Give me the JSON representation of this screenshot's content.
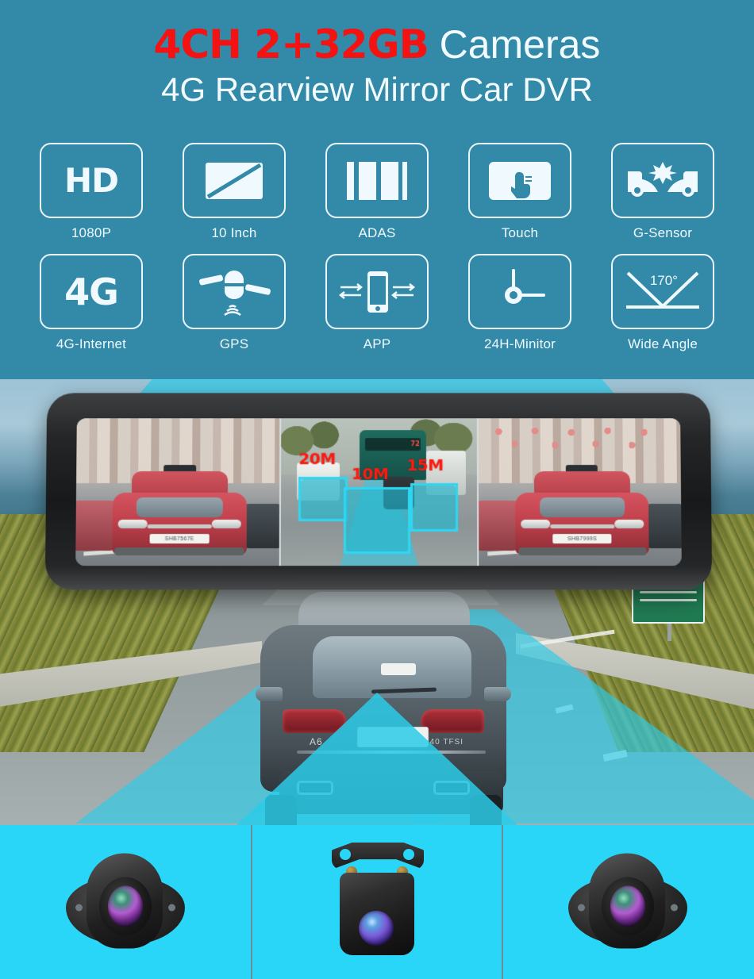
{
  "header": {
    "title_highlight": "4CH 2+32GB",
    "title_rest": " Cameras",
    "subtitle": "4G Rearview Mirror Car DVR",
    "highlight_color": "#f41212",
    "text_color": "#f2fbff",
    "background_color": "#3389a8"
  },
  "features": [
    {
      "icon": "hd-icon",
      "glyph": "HD",
      "label": "1080P"
    },
    {
      "icon": "screen-icon",
      "glyph": "",
      "label": "10 Inch"
    },
    {
      "icon": "adas-bars-icon",
      "glyph": "",
      "label": "ADAS"
    },
    {
      "icon": "touch-hand-icon",
      "glyph": "",
      "label": "Touch"
    },
    {
      "icon": "g-sensor-crash-icon",
      "glyph": "",
      "label": "G-Sensor"
    },
    {
      "icon": "4g-icon",
      "glyph": "4G",
      "label": "4G-Internet"
    },
    {
      "icon": "satellite-icon",
      "glyph": "",
      "label": "GPS"
    },
    {
      "icon": "app-phone-icon",
      "glyph": "",
      "label": "APP"
    },
    {
      "icon": "clock-24h-icon",
      "glyph": "",
      "label": "24H-Minitor"
    },
    {
      "icon": "wide-angle-icon",
      "glyph": "",
      "label": "Wide Angle",
      "angle": "170°"
    }
  ],
  "mirror": {
    "panes": [
      {
        "name": "left-camera-view",
        "plate": "SHB7567E"
      },
      {
        "name": "center-adas-view",
        "bus_route": "72"
      },
      {
        "name": "right-camera-view",
        "plate": "SHB7999S"
      }
    ],
    "adas_distances": [
      "20M",
      "10M",
      "15M"
    ],
    "detection_box_color": "#2fd6f2",
    "distance_text_color": "#ff1a10"
  },
  "road_scene": {
    "car_badge": "A6",
    "car_engine_badge": "40 TFSI",
    "coverage_overlay_color": "#2ccbe8"
  },
  "camera_band": {
    "background_color": "#29d6f7",
    "items": [
      {
        "name": "side-camera-left",
        "type": "bullet-side-camera"
      },
      {
        "name": "rear-camera-center",
        "type": "bracket-rear-camera"
      },
      {
        "name": "side-camera-right",
        "type": "bullet-side-camera"
      }
    ]
  }
}
